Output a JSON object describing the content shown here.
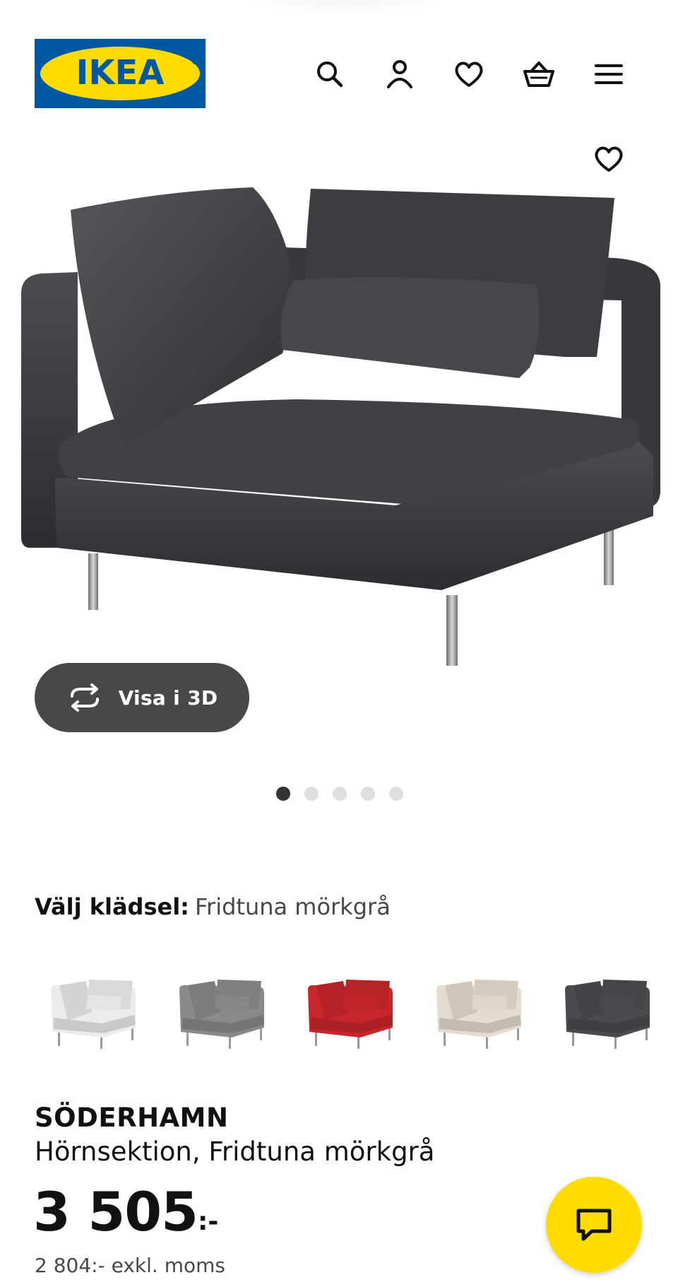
{
  "header": {
    "logo_text": "IKEA",
    "icons": [
      "search-icon",
      "user-icon",
      "heart-icon",
      "cart-icon",
      "menu-icon"
    ]
  },
  "product_image": {
    "favorite_icon": "heart-icon",
    "view_3d_label": "Visa i 3D",
    "carousel": {
      "count": 5,
      "active_index": 0
    }
  },
  "fabric": {
    "label": "Välj klädsel:",
    "selected": "Fridtuna mörkgrå",
    "swatch_colors": [
      "#ececea",
      "#8a8a8a",
      "#c8262c",
      "#e4ddcf",
      "#4a4b4f"
    ],
    "selected_index": 4
  },
  "product": {
    "name": "SÖDERHAMN",
    "description": "Hörnsektion, Fridtuna mörkgrå",
    "price_integer": "3 505",
    "price_suffix": ":-",
    "price_ex_vat": "2 804:- exkl. moms"
  },
  "chat": {
    "icon": "chat-icon"
  },
  "colors": {
    "ikea_blue": "#0058a3",
    "ikea_yellow": "#ffdb00",
    "button_dark": "#484848"
  }
}
